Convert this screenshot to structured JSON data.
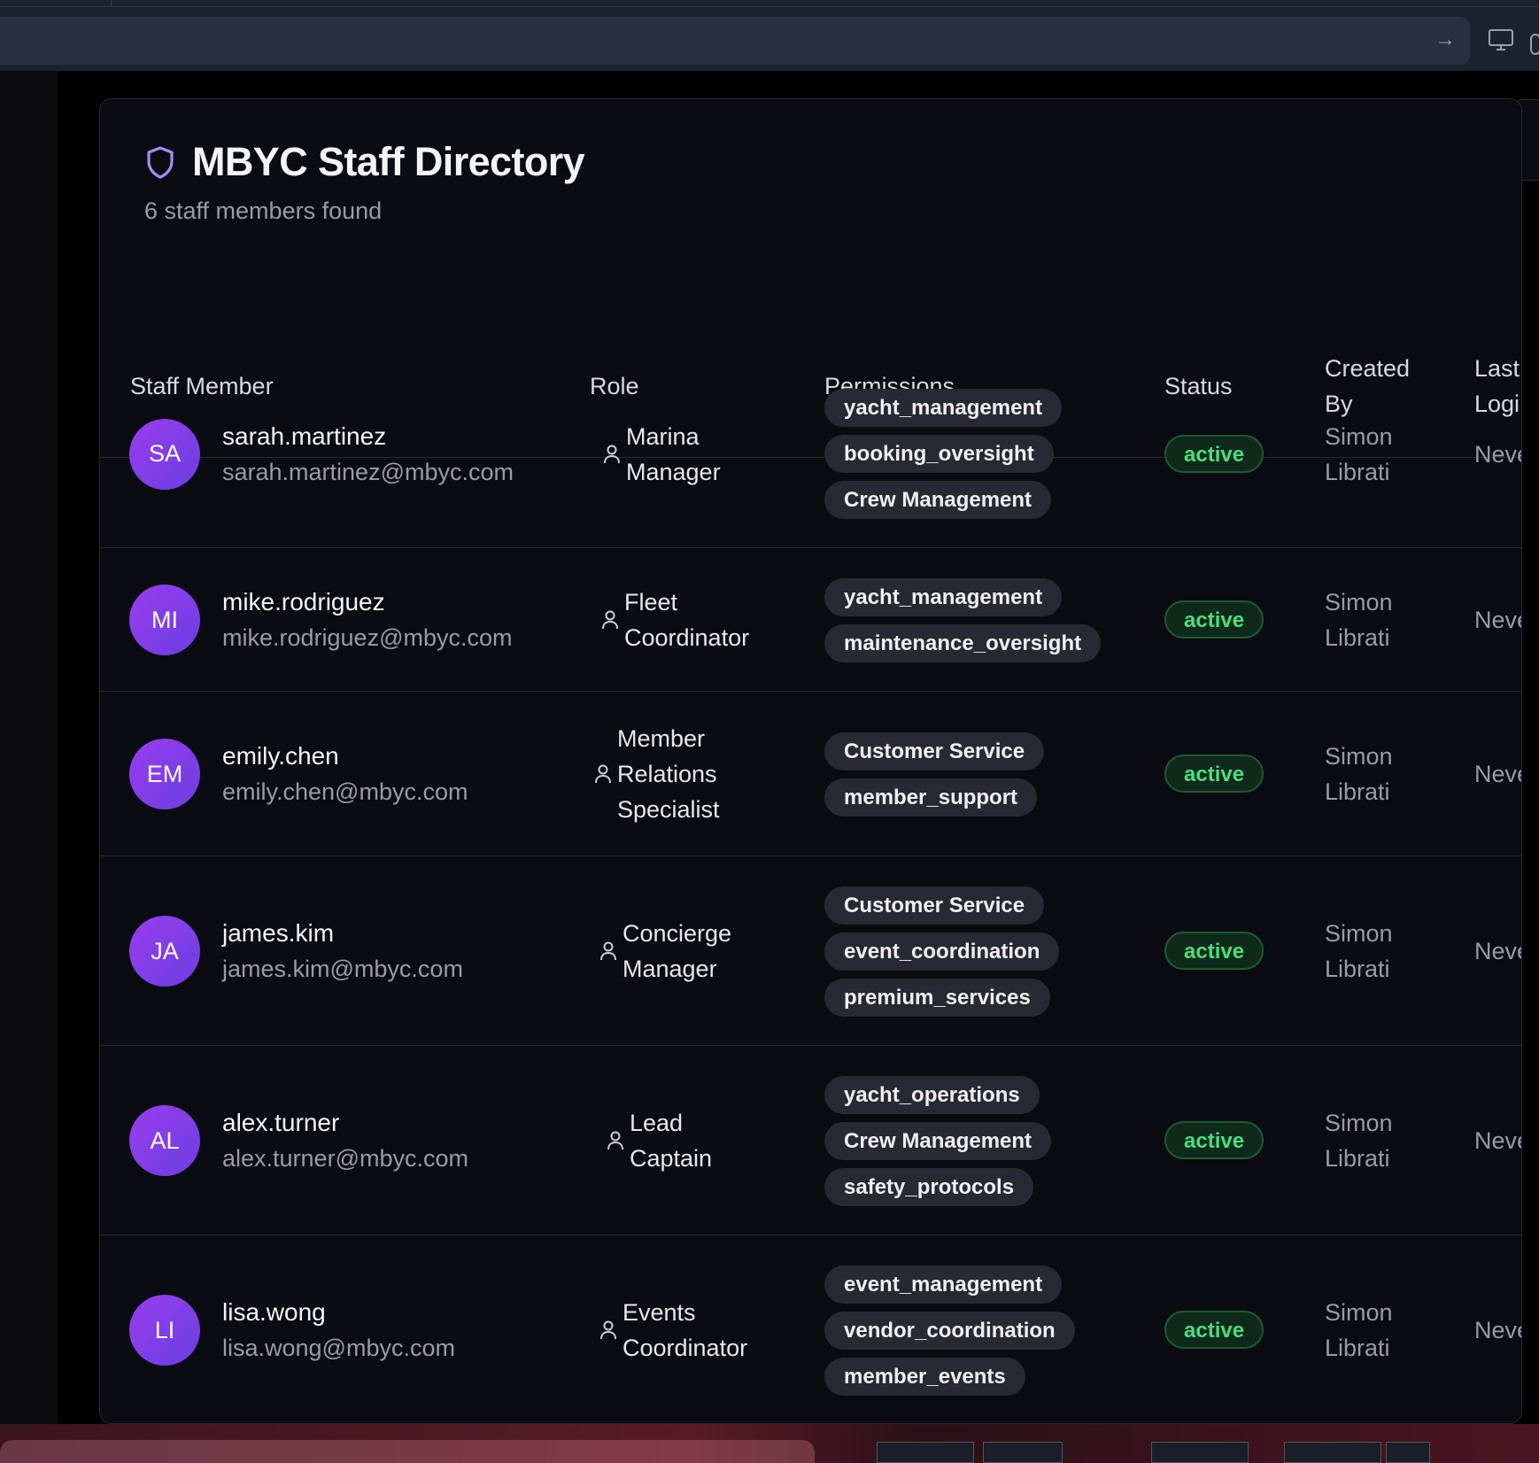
{
  "app": {
    "title": "MBYC Staff Directory",
    "subtitle": "6 staff members found"
  },
  "icons": {
    "title_icon": "shield-icon",
    "role_icon": "person-icon",
    "nav_arrow": "arrow-right-icon",
    "monitor": "monitor-icon"
  },
  "colors": {
    "accent": "#a78bfa",
    "avatar_gradient_start": "#9a3df0",
    "avatar_gradient_end": "#6a3fe0",
    "status_active": "#4ade80"
  },
  "columns": {
    "staff_member": "Staff Member",
    "role": "Role",
    "permissions": "Permissions",
    "status": "Status",
    "created_by_1": "Created",
    "created_by_2": "By",
    "last_login_1": "Last",
    "last_login_2": "Logi"
  },
  "staff": [
    {
      "initials": "SA",
      "username": "sarah.martinez",
      "email": "sarah.martinez@mbyc.com",
      "role": [
        "Marina",
        "Manager"
      ],
      "permissions": [
        "yacht_management",
        "booking_oversight",
        "Crew Management"
      ],
      "status": "active",
      "created_by": [
        "Simon",
        "Librati"
      ],
      "last_login": "Neve"
    },
    {
      "initials": "MI",
      "username": "mike.rodriguez",
      "email": "mike.rodriguez@mbyc.com",
      "role": [
        "Fleet",
        "Coordinator"
      ],
      "permissions": [
        "yacht_management",
        "maintenance_oversight"
      ],
      "status": "active",
      "created_by": [
        "Simon",
        "Librati"
      ],
      "last_login": "Neve"
    },
    {
      "initials": "EM",
      "username": "emily.chen",
      "email": "emily.chen@mbyc.com",
      "role": [
        "Member",
        "Relations",
        "Specialist"
      ],
      "permissions": [
        "Customer Service",
        "member_support"
      ],
      "status": "active",
      "created_by": [
        "Simon",
        "Librati"
      ],
      "last_login": "Neve"
    },
    {
      "initials": "JA",
      "username": "james.kim",
      "email": "james.kim@mbyc.com",
      "role": [
        "Concierge",
        "Manager"
      ],
      "permissions": [
        "Customer Service",
        "event_coordination",
        "premium_services"
      ],
      "status": "active",
      "created_by": [
        "Simon",
        "Librati"
      ],
      "last_login": "Neve"
    },
    {
      "initials": "AL",
      "username": "alex.turner",
      "email": "alex.turner@mbyc.com",
      "role": [
        "Lead",
        "Captain"
      ],
      "permissions": [
        "yacht_operations",
        "Crew Management",
        "safety_protocols"
      ],
      "status": "active",
      "created_by": [
        "Simon",
        "Librati"
      ],
      "last_login": "Neve"
    },
    {
      "initials": "LI",
      "username": "lisa.wong",
      "email": "lisa.wong@mbyc.com",
      "role": [
        "Events",
        "Coordinator"
      ],
      "permissions": [
        "event_management",
        "vendor_coordination",
        "member_events"
      ],
      "status": "active",
      "created_by": [
        "Simon",
        "Librati"
      ],
      "last_login": "Neve"
    }
  ]
}
